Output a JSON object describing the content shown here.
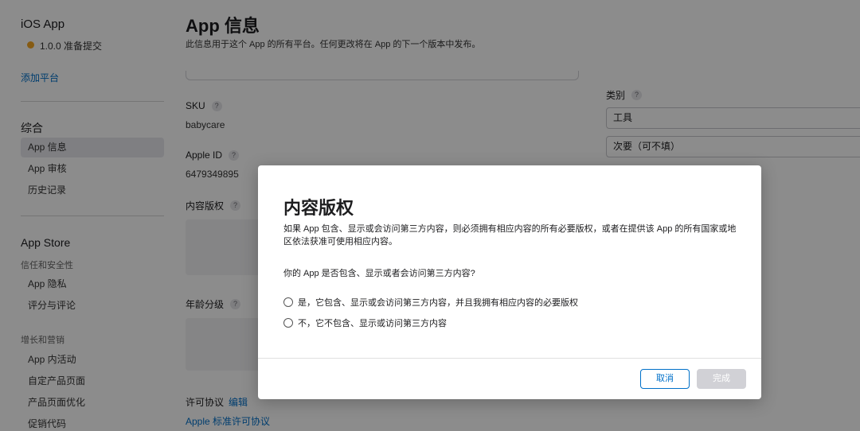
{
  "sidebar": {
    "app_title": "iOS App",
    "version": "1.0.0 准备提交",
    "add_platform": "添加平台",
    "section_general": "综合",
    "general_items": [
      "App 信息",
      "App 审核",
      "历史记录"
    ],
    "section_appstore": "App Store",
    "group_trust": "信任和安全性",
    "trust_items": [
      "App 隐私",
      "评分与评论"
    ],
    "group_growth": "增长和营销",
    "growth_items": [
      "App 内活动",
      "自定产品页面",
      "产品页面优化",
      "促销代码"
    ]
  },
  "main": {
    "title": "App 信息",
    "subtitle": "此信息用于这个 App 的所有平台。任何更改将在 App 的下一个版本中发布。",
    "sku_label": "SKU",
    "sku_value": "babycare",
    "appleid_label": "Apple ID",
    "appleid_value": "6479349895",
    "content_rights_label": "内容版权",
    "age_rating_label": "年龄分级",
    "license_label": "许可协议",
    "license_edit": "编辑",
    "license_value": "Apple 标准许可协议",
    "help_glyph": "?"
  },
  "category": {
    "label": "类别",
    "primary": "工具",
    "secondary": "次要（可不填）"
  },
  "modal": {
    "title": "内容版权",
    "description": "如果 App 包含、显示或会访问第三方内容，则必须拥有相应内容的所有必要版权，或者在提供该 App 的所有国家或地区依法获准可使用相应内容。",
    "question": "你的 App 是否包含、显示或者会访问第三方内容?",
    "option_yes": "是，它包含、显示或会访问第三方内容，并且我拥有相应内容的必要版权",
    "option_no": "不，它不包含、显示或访问第三方内容",
    "cancel_label": "取消",
    "done_label": "完成"
  }
}
